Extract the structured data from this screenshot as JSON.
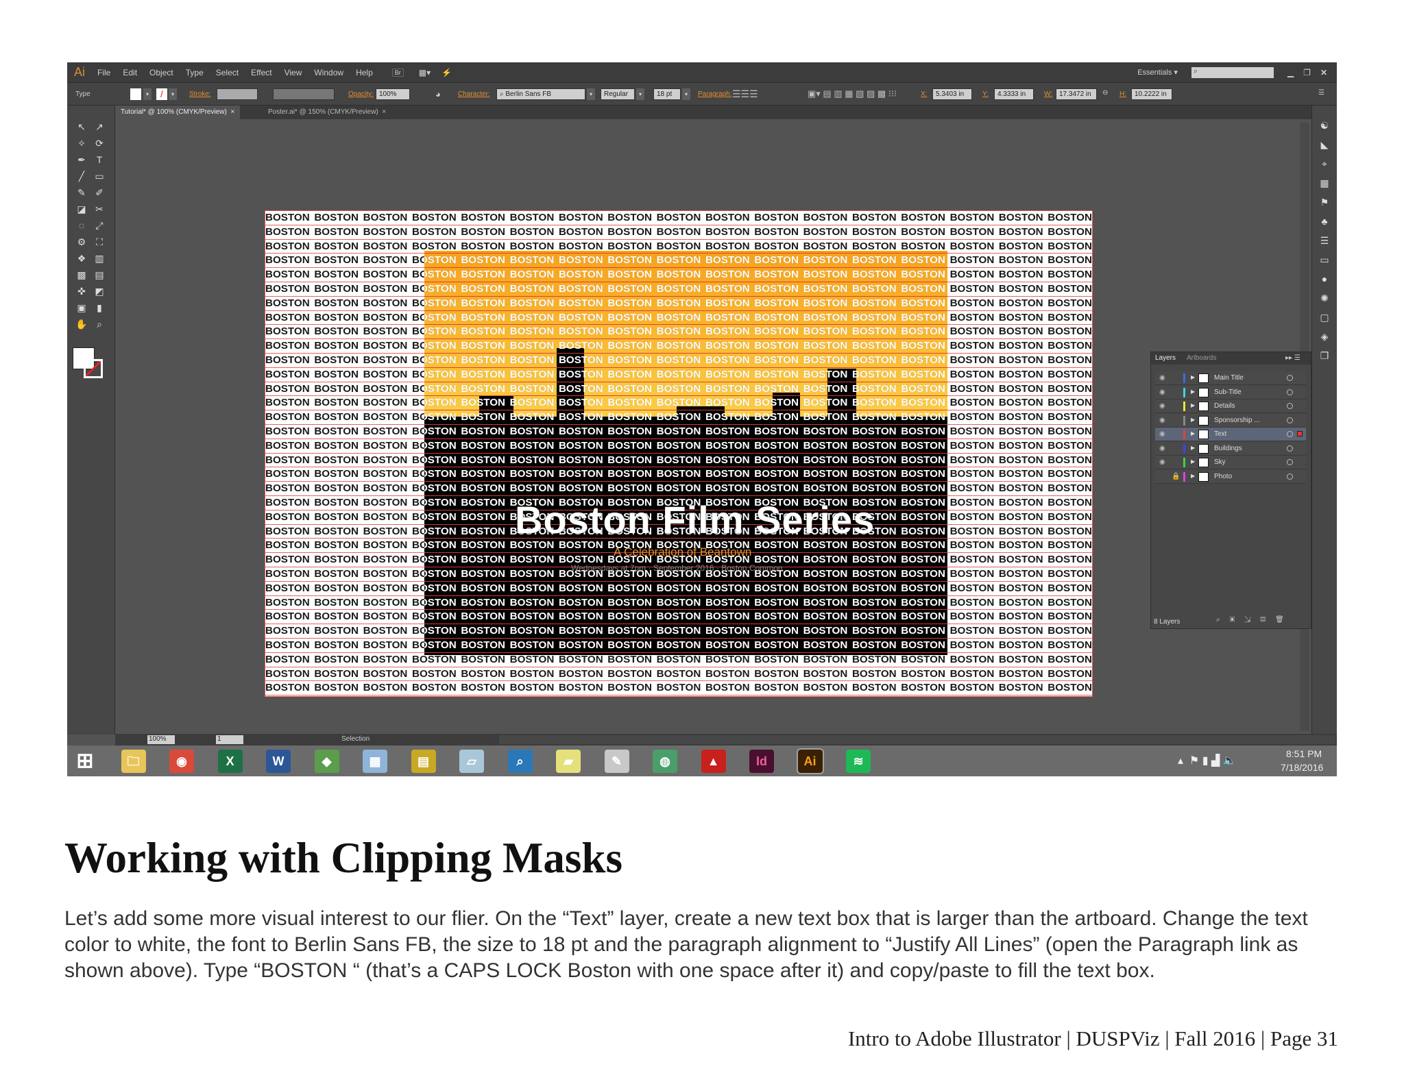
{
  "app": {
    "logo": "Ai",
    "menus": [
      "File",
      "Edit",
      "Object",
      "Type",
      "Select",
      "Effect",
      "View",
      "Window",
      "Help"
    ],
    "workspace": "Essentials",
    "window_controls": [
      "minimize",
      "restore",
      "close"
    ]
  },
  "control_bar": {
    "mode": "Type",
    "stroke_label": "Stroke:",
    "opacity_label": "Opacity:",
    "opacity": "100%",
    "character_label": "Character:",
    "font": "Berlin Sans FB",
    "style": "Regular",
    "size": "18 pt",
    "paragraph_label": "Paragraph:",
    "x_label": "X:",
    "x": "5.3403 in",
    "y_label": "Y:",
    "y": "4.3333 in",
    "w_label": "W:",
    "w": "17.3472 in",
    "h_label": "H:",
    "h": "10.2222 in"
  },
  "tabs": [
    {
      "label": "Tutorial* @ 100% (CMYK/Preview)",
      "active": true
    },
    {
      "label": "Poster.ai* @ 150% (CMYK/Preview)",
      "active": false
    }
  ],
  "artwork": {
    "fill_word": "BOSTON",
    "rows": 34,
    "words_per_row": 17,
    "title": "Boston Film Series",
    "subtitle": "A Celebration of Beantown",
    "details": "Wednesdays at 7pm  ·  September 2016  ·  Boston Common"
  },
  "layers_panel": {
    "tabs": [
      "Layers",
      "Artboards"
    ],
    "footer": "8 Layers",
    "layers": [
      {
        "name": "Main Title",
        "color": "#3d6be0",
        "visible": true,
        "locked": false,
        "selected": false
      },
      {
        "name": "Sub-Title",
        "color": "#3ed5e0",
        "visible": true,
        "locked": false,
        "selected": false
      },
      {
        "name": "Details",
        "color": "#f3e33a",
        "visible": true,
        "locked": false,
        "selected": false
      },
      {
        "name": "Sponsorship ...",
        "color": "#888888",
        "visible": true,
        "locked": false,
        "selected": false
      },
      {
        "name": "Text",
        "color": "#e04040",
        "visible": true,
        "locked": false,
        "selected": true
      },
      {
        "name": "Buildings",
        "color": "#4343e0",
        "visible": true,
        "locked": false,
        "selected": false
      },
      {
        "name": "Sky",
        "color": "#3ed04a",
        "visible": true,
        "locked": false,
        "selected": false
      },
      {
        "name": "Photo",
        "color": "#e040e0",
        "visible": false,
        "locked": true,
        "selected": false
      }
    ]
  },
  "status_bar": {
    "zoom": "100%",
    "artboard": "1",
    "tool": "Selection"
  },
  "taskbar": {
    "apps": [
      {
        "name": "start",
        "glyph": "⊞",
        "bg": "transparent"
      },
      {
        "name": "file-explorer",
        "glyph": "🗀",
        "bg": "#e8c559"
      },
      {
        "name": "chrome",
        "glyph": "◉",
        "bg": "#d94a3a"
      },
      {
        "name": "excel",
        "glyph": "X",
        "bg": "#1e7145"
      },
      {
        "name": "word",
        "glyph": "W",
        "bg": "#2b5797"
      },
      {
        "name": "git-extensions",
        "glyph": "◆",
        "bg": "#5a9e4b"
      },
      {
        "name": "calculator",
        "glyph": "▦",
        "bg": "#8fb4d9"
      },
      {
        "name": "file-cabinet",
        "glyph": "▤",
        "bg": "#c9a826"
      },
      {
        "name": "notepad",
        "glyph": "▱",
        "bg": "#a9c7d8"
      },
      {
        "name": "magnifier",
        "glyph": "⌕",
        "bg": "#2a78b8"
      },
      {
        "name": "sticky-notes",
        "glyph": "▰",
        "bg": "#e6e07a"
      },
      {
        "name": "paint",
        "glyph": "✎",
        "bg": "#c8c8c8"
      },
      {
        "name": "globe",
        "glyph": "◍",
        "bg": "#4a9e6a"
      },
      {
        "name": "acrobat",
        "glyph": "▲",
        "bg": "#c8201c"
      },
      {
        "name": "indesign",
        "glyph": "Id",
        "bg": "#48102e"
      },
      {
        "name": "illustrator",
        "glyph": "Ai",
        "bg": "#3a2005"
      },
      {
        "name": "spotify",
        "glyph": "≋",
        "bg": "#1db954"
      }
    ],
    "time": "8:51 PM",
    "date": "7/18/2016"
  },
  "document": {
    "heading": "Working with Clipping Masks",
    "paragraph": "Let’s add some more visual interest to our flier. On the “Text” layer, create a new text box that is larger than the artboard. Change the text color to white, the font to Berlin Sans FB, the size to 18 pt and the paragraph alignment to “Justify All Lines” (open the Paragraph link as shown above). Type “BOSTON “ (that’s a CAPS LOCK Boston with one space after it) and copy/paste to fill the text box.",
    "footer": "Intro to Adobe Illustrator | DUSPViz | Fall 2016 | Page 31"
  }
}
